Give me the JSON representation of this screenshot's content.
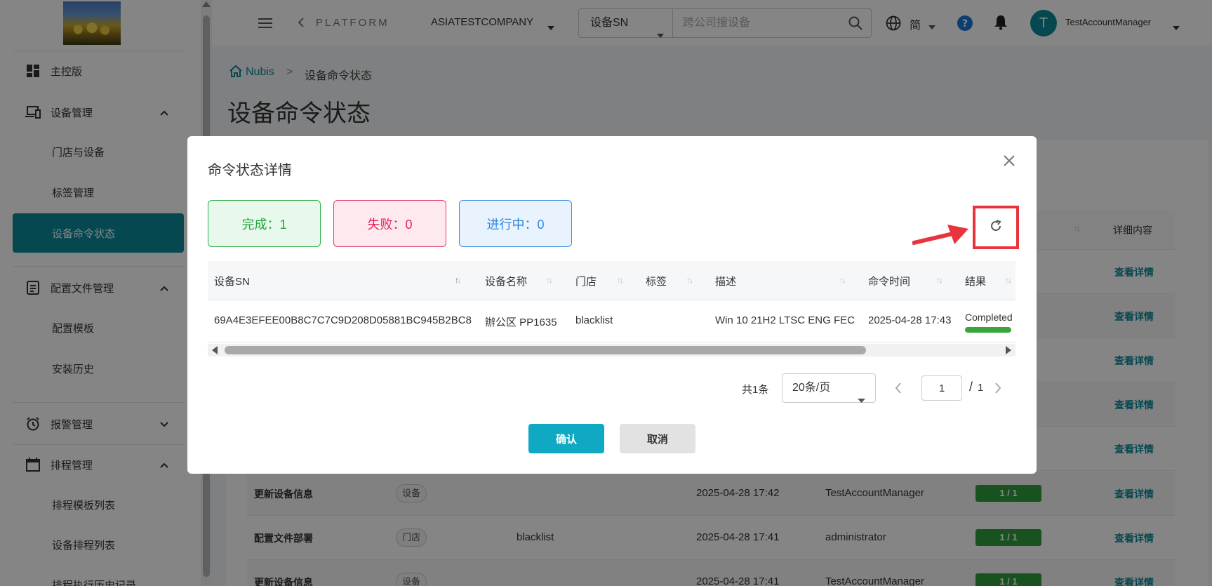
{
  "sidebar": {
    "items": [
      {
        "label": "主控版"
      },
      {
        "label": "设备管理"
      },
      {
        "label": "门店与设备"
      },
      {
        "label": "标签管理"
      },
      {
        "label": "设备命令状态"
      },
      {
        "label": "配置文件管理"
      },
      {
        "label": "配置模板"
      },
      {
        "label": "安装历史"
      },
      {
        "label": "报警管理"
      },
      {
        "label": "排程管理"
      },
      {
        "label": "排程模板列表"
      },
      {
        "label": "设备排程列表"
      },
      {
        "label": "排程执行历史记录"
      }
    ]
  },
  "header": {
    "platform": "PLATFORM",
    "company": "ASIATESTCOMPANY",
    "search_type": "设备SN",
    "search_placeholder": "跨公司搜设备",
    "language": "简",
    "avatar_letter": "T",
    "username": "TestAccountManager"
  },
  "breadcrumb": {
    "home": "Nubis",
    "separator": ">",
    "current": "设备命令状态"
  },
  "page_title": "设备命令状态",
  "background_table": {
    "header_detail": "详细内容",
    "rows": [
      {
        "link": "查看详情",
        "badge_color": "green"
      },
      {
        "link": "查看详情",
        "badge_color": "green"
      },
      {
        "link": "查看详情",
        "badge_color": "red"
      },
      {
        "link": "查看详情",
        "badge_color": "green"
      },
      {
        "link": "查看详情",
        "badge_color": "red"
      },
      {
        "name": "更新设备信息",
        "tag": "设备",
        "target": "",
        "time": "2025-04-28 17:42",
        "user": "TestAccountManager",
        "badge": "1 / 1",
        "badge_color": "green",
        "link": "查看详情"
      },
      {
        "name": "配置文件部署",
        "tag": "门店",
        "target": "blacklist",
        "time": "2025-04-28 17:41",
        "user": "administrator",
        "badge": "1 / 1",
        "badge_color": "green",
        "link": "查看详情"
      },
      {
        "name": "更新设备信息",
        "tag": "设备",
        "target": "",
        "time": "2025-04-28 17:41",
        "user": "TestAccountManager",
        "badge": "1 / 1",
        "badge_color": "green",
        "link": "查看详情"
      }
    ]
  },
  "modal": {
    "title": "命令状态详情",
    "stats": {
      "done": "完成：1",
      "failed": "失败：0",
      "in_progress": "进行中：0"
    },
    "columns": {
      "sn": "设备SN",
      "name": "设备名称",
      "store": "门店",
      "tag": "标签",
      "desc": "描述",
      "time": "命令时间",
      "result": "结果"
    },
    "row": {
      "sn": "69A4E3EFEE00B8C7C7C9D208D05881BC945B2BC8",
      "name": "辦公区 PP1635",
      "store": "blacklist",
      "tag": "",
      "desc": "Win 10 21H2 LTSC ENG FEC",
      "time": "2025-04-28 17:43",
      "result": "Completed",
      "progress": 1.0
    },
    "pagination": {
      "total": "共1条",
      "page_size": "20条/页",
      "current_page": "1",
      "slash": "/",
      "total_pages": "1"
    },
    "confirm": "确认",
    "cancel": "取消"
  },
  "colors": {
    "accent": "#0b8a9a",
    "confirm": "#0fa9c4",
    "done": "#1fa63a",
    "failed": "#e0285a",
    "in_progress": "#2f86dc",
    "highlight": "#e8343c"
  }
}
